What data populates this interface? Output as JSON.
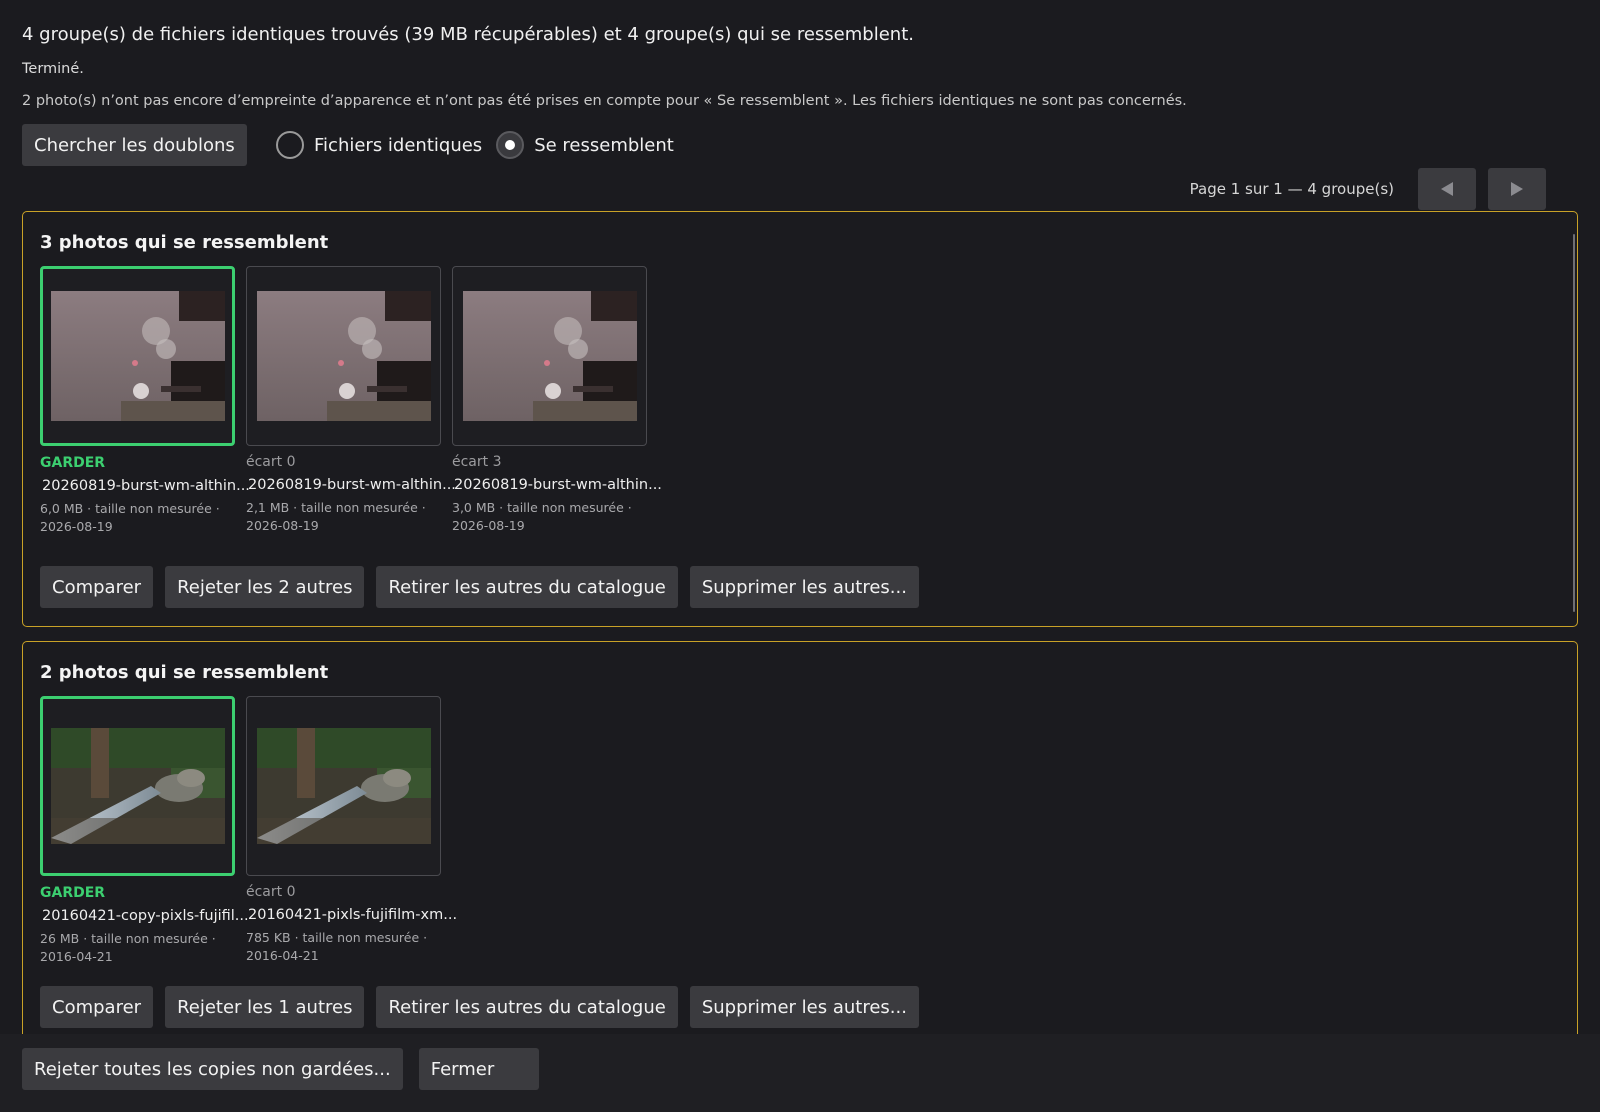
{
  "summary": "4 groupe(s) de fichiers identiques trouvés (39 MB récupérables) et 4 groupe(s) qui se ressemblent.",
  "status": "Terminé.",
  "notice": "2 photo(s) n’ont pas encore d’empreinte d’apparence et n’ont pas été prises en compte pour « Se ressemblent ». Les fichiers identiques ne sont pas concernés.",
  "search_button": "Chercher les doublons",
  "mode": {
    "options": [
      "Fichiers identiques",
      "Se ressemblent"
    ],
    "selected": "Se ressemblent"
  },
  "pager": {
    "text": "Page 1 sur 1 — 4 groupe(s)",
    "prev_icon": "triangle-left-icon",
    "next_icon": "triangle-right-icon"
  },
  "colors": {
    "accent_border": "#c9a227",
    "keep_green": "#3ccf70",
    "button_bg": "#3b3b3f",
    "background": "#1b1b1f"
  },
  "groups": [
    {
      "title": "3 photos qui se ressemblent",
      "photos": [
        {
          "label": "GARDER",
          "keep": true,
          "filename": "20260819-burst-wm-althin...",
          "meta1": "6,0 MB · taille non mesurée ·",
          "meta2": "2026-08-19"
        },
        {
          "label": "écart 0",
          "keep": false,
          "filename": "20260819-burst-wm-althin...",
          "meta1": "2,1 MB · taille non mesurée ·",
          "meta2": "2026-08-19"
        },
        {
          "label": "écart 3",
          "keep": false,
          "filename": "20260819-burst-wm-althin...",
          "meta1": "3,0 MB · taille non mesurée ·",
          "meta2": "2026-08-19"
        }
      ],
      "actions": {
        "compare": "Comparer",
        "reject": "Rejeter les 2 autres",
        "remove": "Retirer les autres du catalogue",
        "delete": "Supprimer les autres..."
      }
    },
    {
      "title": "2 photos qui se ressemblent",
      "photos": [
        {
          "label": "GARDER",
          "keep": true,
          "filename": "20160421-copy-pixls-fujifil...",
          "meta1": "26 MB · taille non mesurée ·",
          "meta2": "2016-04-21"
        },
        {
          "label": "écart 0",
          "keep": false,
          "filename": "20160421-pixls-fujifilm-xm...",
          "meta1": "785 KB · taille non mesurée ·",
          "meta2": "2016-04-21"
        }
      ],
      "actions": {
        "compare": "Comparer",
        "reject": "Rejeter les 1 autres",
        "remove": "Retirer les autres du catalogue",
        "delete": "Supprimer les autres..."
      }
    }
  ],
  "footer": {
    "reject_all": "Rejeter toutes les copies non gardées...",
    "close": "Fermer"
  }
}
